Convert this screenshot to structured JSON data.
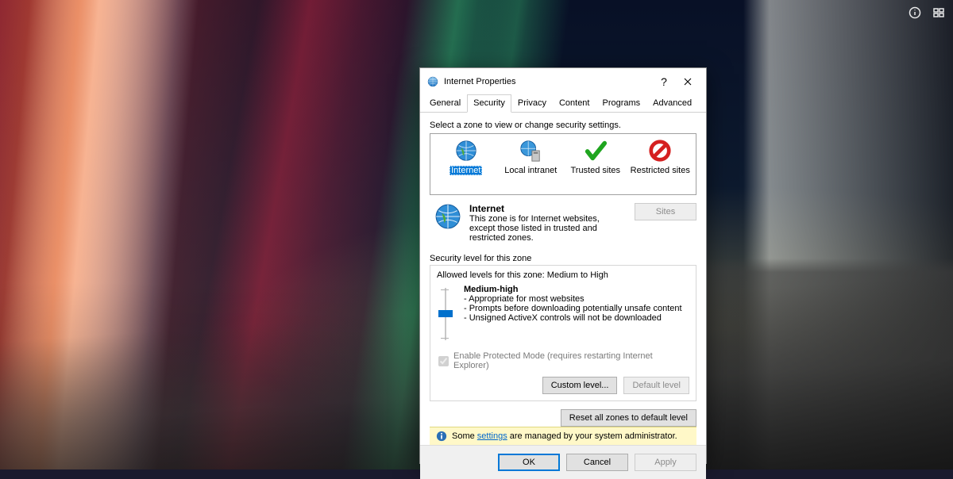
{
  "dialog": {
    "title": "Internet Properties",
    "tabs": [
      "General",
      "Security",
      "Privacy",
      "Content",
      "Programs",
      "Advanced"
    ],
    "active_tab": 1,
    "select_zone_prompt": "Select a zone to view or change security settings.",
    "zones": [
      {
        "label": "Internet",
        "icon": "globe"
      },
      {
        "label": "Local intranet",
        "icon": "globe"
      },
      {
        "label": "Trusted sites",
        "icon": "check"
      },
      {
        "label": "Restricted sites",
        "icon": "forbid"
      }
    ],
    "selected_zone": 0,
    "zone_name": "Internet",
    "zone_description": "This zone is for Internet websites, except those listed in trusted and restricted zones.",
    "sites_button": "Sites",
    "security_level_header": "Security level for this zone",
    "allowed_levels": "Allowed levels for this zone: Medium to High",
    "level_name": "Medium-high",
    "level_bullets": [
      "- Appropriate for most websites",
      "- Prompts before downloading potentially unsafe content",
      "- Unsigned ActiveX controls will not be downloaded"
    ],
    "protected_mode": "Enable Protected Mode (requires restarting Internet Explorer)",
    "custom_level": "Custom level...",
    "default_level": "Default level",
    "reset_all": "Reset all zones to default level",
    "info_pre": "Some ",
    "info_link": "settings",
    "info_post": " are managed by your system administrator.",
    "ok": "OK",
    "cancel": "Cancel",
    "apply": "Apply"
  }
}
